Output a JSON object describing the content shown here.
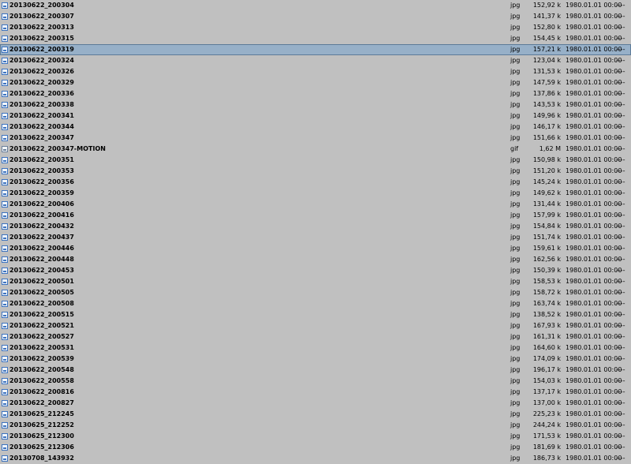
{
  "files": [
    {
      "name": "20130622_200304",
      "ext": "jpg",
      "size": "152,92 k",
      "date": "1980.01.01 00:00",
      "attr": "----",
      "icon": "image-file-icon"
    },
    {
      "name": "20130622_200307",
      "ext": "jpg",
      "size": "141,37 k",
      "date": "1980.01.01 00:00",
      "attr": "----",
      "icon": "image-file-icon"
    },
    {
      "name": "20130622_200313",
      "ext": "jpg",
      "size": "152,80 k",
      "date": "1980.01.01 00:00",
      "attr": "----",
      "icon": "image-file-icon"
    },
    {
      "name": "20130622_200315",
      "ext": "jpg",
      "size": "154,45 k",
      "date": "1980.01.01 00:00",
      "attr": "----",
      "icon": "image-file-icon"
    },
    {
      "name": "20130622_200319",
      "ext": "jpg",
      "size": "157,21 k",
      "date": "1980.01.01 00:00",
      "attr": "----",
      "icon": "image-file-icon",
      "selected": true
    },
    {
      "name": "20130622_200324",
      "ext": "jpg",
      "size": "123,04 k",
      "date": "1980.01.01 00:00",
      "attr": "----",
      "icon": "image-file-icon"
    },
    {
      "name": "20130622_200326",
      "ext": "jpg",
      "size": "131,53 k",
      "date": "1980.01.01 00:00",
      "attr": "----",
      "icon": "image-file-icon"
    },
    {
      "name": "20130622_200329",
      "ext": "jpg",
      "size": "147,59 k",
      "date": "1980.01.01 00:00",
      "attr": "----",
      "icon": "image-file-icon"
    },
    {
      "name": "20130622_200336",
      "ext": "jpg",
      "size": "137,86 k",
      "date": "1980.01.01 00:00",
      "attr": "----",
      "icon": "image-file-icon"
    },
    {
      "name": "20130622_200338",
      "ext": "jpg",
      "size": "143,53 k",
      "date": "1980.01.01 00:00",
      "attr": "----",
      "icon": "image-file-icon"
    },
    {
      "name": "20130622_200341",
      "ext": "jpg",
      "size": "149,96 k",
      "date": "1980.01.01 00:00",
      "attr": "----",
      "icon": "image-file-icon"
    },
    {
      "name": "20130622_200344",
      "ext": "jpg",
      "size": "146,17 k",
      "date": "1980.01.01 00:00",
      "attr": "----",
      "icon": "image-file-icon"
    },
    {
      "name": "20130622_200347",
      "ext": "jpg",
      "size": "151,66 k",
      "date": "1980.01.01 00:00",
      "attr": "----",
      "icon": "image-file-icon"
    },
    {
      "name": "20130622_200347-MOTION",
      "ext": "gif",
      "size": "1,62 M",
      "date": "1980.01.01 00:00",
      "attr": "----",
      "icon": "gif-file-icon"
    },
    {
      "name": "20130622_200351",
      "ext": "jpg",
      "size": "150,98 k",
      "date": "1980.01.01 00:00",
      "attr": "----",
      "icon": "image-file-icon"
    },
    {
      "name": "20130622_200353",
      "ext": "jpg",
      "size": "151,20 k",
      "date": "1980.01.01 00:00",
      "attr": "----",
      "icon": "image-file-icon"
    },
    {
      "name": "20130622_200356",
      "ext": "jpg",
      "size": "145,24 k",
      "date": "1980.01.01 00:00",
      "attr": "----",
      "icon": "image-file-icon"
    },
    {
      "name": "20130622_200359",
      "ext": "jpg",
      "size": "149,62 k",
      "date": "1980.01.01 00:00",
      "attr": "----",
      "icon": "image-file-icon"
    },
    {
      "name": "20130622_200406",
      "ext": "jpg",
      "size": "131,44 k",
      "date": "1980.01.01 00:00",
      "attr": "----",
      "icon": "image-file-icon"
    },
    {
      "name": "20130622_200416",
      "ext": "jpg",
      "size": "157,99 k",
      "date": "1980.01.01 00:00",
      "attr": "----",
      "icon": "image-file-icon"
    },
    {
      "name": "20130622_200432",
      "ext": "jpg",
      "size": "154,84 k",
      "date": "1980.01.01 00:00",
      "attr": "----",
      "icon": "image-file-icon"
    },
    {
      "name": "20130622_200437",
      "ext": "jpg",
      "size": "151,74 k",
      "date": "1980.01.01 00:00",
      "attr": "----",
      "icon": "image-file-icon"
    },
    {
      "name": "20130622_200446",
      "ext": "jpg",
      "size": "159,61 k",
      "date": "1980.01.01 00:00",
      "attr": "----",
      "icon": "image-file-icon"
    },
    {
      "name": "20130622_200448",
      "ext": "jpg",
      "size": "162,56 k",
      "date": "1980.01.01 00:00",
      "attr": "----",
      "icon": "image-file-icon"
    },
    {
      "name": "20130622_200453",
      "ext": "jpg",
      "size": "150,39 k",
      "date": "1980.01.01 00:00",
      "attr": "----",
      "icon": "image-file-icon"
    },
    {
      "name": "20130622_200501",
      "ext": "jpg",
      "size": "158,53 k",
      "date": "1980.01.01 00:00",
      "attr": "----",
      "icon": "image-file-icon"
    },
    {
      "name": "20130622_200505",
      "ext": "jpg",
      "size": "158,72 k",
      "date": "1980.01.01 00:00",
      "attr": "----",
      "icon": "image-file-icon"
    },
    {
      "name": "20130622_200508",
      "ext": "jpg",
      "size": "163,74 k",
      "date": "1980.01.01 00:00",
      "attr": "----",
      "icon": "image-file-icon"
    },
    {
      "name": "20130622_200515",
      "ext": "jpg",
      "size": "138,52 k",
      "date": "1980.01.01 00:00",
      "attr": "----",
      "icon": "image-file-icon"
    },
    {
      "name": "20130622_200521",
      "ext": "jpg",
      "size": "167,93 k",
      "date": "1980.01.01 00:00",
      "attr": "----",
      "icon": "image-file-icon"
    },
    {
      "name": "20130622_200527",
      "ext": "jpg",
      "size": "161,31 k",
      "date": "1980.01.01 00:00",
      "attr": "----",
      "icon": "image-file-icon"
    },
    {
      "name": "20130622_200531",
      "ext": "jpg",
      "size": "164,60 k",
      "date": "1980.01.01 00:00",
      "attr": "----",
      "icon": "image-file-icon"
    },
    {
      "name": "20130622_200539",
      "ext": "jpg",
      "size": "174,09 k",
      "date": "1980.01.01 00:00",
      "attr": "----",
      "icon": "image-file-icon"
    },
    {
      "name": "20130622_200548",
      "ext": "jpg",
      "size": "196,17 k",
      "date": "1980.01.01 00:00",
      "attr": "----",
      "icon": "image-file-icon"
    },
    {
      "name": "20130622_200558",
      "ext": "jpg",
      "size": "154,03 k",
      "date": "1980.01.01 00:00",
      "attr": "----",
      "icon": "image-file-icon"
    },
    {
      "name": "20130622_200816",
      "ext": "jpg",
      "size": "137,17 k",
      "date": "1980.01.01 00:00",
      "attr": "----",
      "icon": "image-file-icon"
    },
    {
      "name": "20130622_200827",
      "ext": "jpg",
      "size": "137,00 k",
      "date": "1980.01.01 00:00",
      "attr": "----",
      "icon": "image-file-icon"
    },
    {
      "name": "20130625_212245",
      "ext": "jpg",
      "size": "225,23 k",
      "date": "1980.01.01 00:00",
      "attr": "----",
      "icon": "image-file-icon"
    },
    {
      "name": "20130625_212252",
      "ext": "jpg",
      "size": "244,24 k",
      "date": "1980.01.01 00:00",
      "attr": "----",
      "icon": "image-file-icon"
    },
    {
      "name": "20130625_212300",
      "ext": "jpg",
      "size": "171,53 k",
      "date": "1980.01.01 00:00",
      "attr": "----",
      "icon": "image-file-icon"
    },
    {
      "name": "20130625_212306",
      "ext": "jpg",
      "size": "181,69 k",
      "date": "1980.01.01 00:00",
      "attr": "----",
      "icon": "image-file-icon"
    },
    {
      "name": "20130708_143932",
      "ext": "jpg",
      "size": "186,73 k",
      "date": "1980.01.01 00:00",
      "attr": "----",
      "icon": "image-file-icon"
    }
  ]
}
